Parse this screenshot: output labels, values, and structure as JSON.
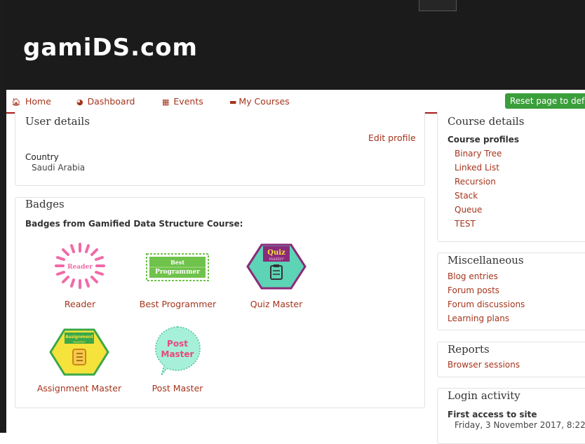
{
  "site": {
    "logo": "gamiDS.com"
  },
  "nav": {
    "items": [
      {
        "label": "Home",
        "icon": "home-icon"
      },
      {
        "label": "Dashboard",
        "icon": "dashboard-icon"
      },
      {
        "label": "Events",
        "icon": "calendar-icon"
      },
      {
        "label": "My Courses",
        "icon": "briefcase-icon"
      }
    ],
    "reset_button": "Reset page to defa"
  },
  "user_details": {
    "title": "User details",
    "edit_profile": "Edit profile",
    "country_label": "Country",
    "country_value": "Saudi Arabia"
  },
  "badges": {
    "title": "Badges",
    "subtitle": "Badges from Gamified Data Structure Course:",
    "items": [
      {
        "name": "Reader",
        "art_text": "Reader"
      },
      {
        "name": "Best Programmer",
        "art_text_1": "Best",
        "art_text_2": "Programmer"
      },
      {
        "name": "Quiz Master",
        "art_text_1": "Quiz",
        "art_text_2": "master"
      },
      {
        "name": "Assignment Master",
        "art_text_1": "Assignment",
        "art_text_2": "master"
      },
      {
        "name": "Post Master",
        "art_text_1": "Post",
        "art_text_2": "Master"
      }
    ]
  },
  "course_details": {
    "title": "Course details",
    "profiles_label": "Course profiles",
    "profiles": [
      "Binary Tree",
      "Linked List",
      "Recursion",
      "Stack",
      "Queue",
      "TEST"
    ]
  },
  "misc": {
    "title": "Miscellaneous",
    "links": [
      "Blog entries",
      "Forum posts",
      "Forum discussions",
      "Learning plans"
    ]
  },
  "reports": {
    "title": "Reports",
    "links": [
      "Browser sessions"
    ]
  },
  "login_activity": {
    "title": "Login activity",
    "first_access_label": "First access to site",
    "first_access_value": "Friday, 3 November 2017, 8:22"
  },
  "colors": {
    "link": "#a5341c",
    "header_bg": "#1b1b1b",
    "nav_border": "#a61b1b",
    "reset_bg": "#3a9e3a",
    "reader_pink": "#f06aa8",
    "programmer_green": "#6fc24b",
    "quiz_teal": "#5dd4b5",
    "quiz_purple": "#8a2a7a",
    "assignment_yellow": "#f5e23a",
    "assignment_green": "#3aa84b",
    "post_teal": "#a6f0d9",
    "post_pink": "#e8487a"
  }
}
